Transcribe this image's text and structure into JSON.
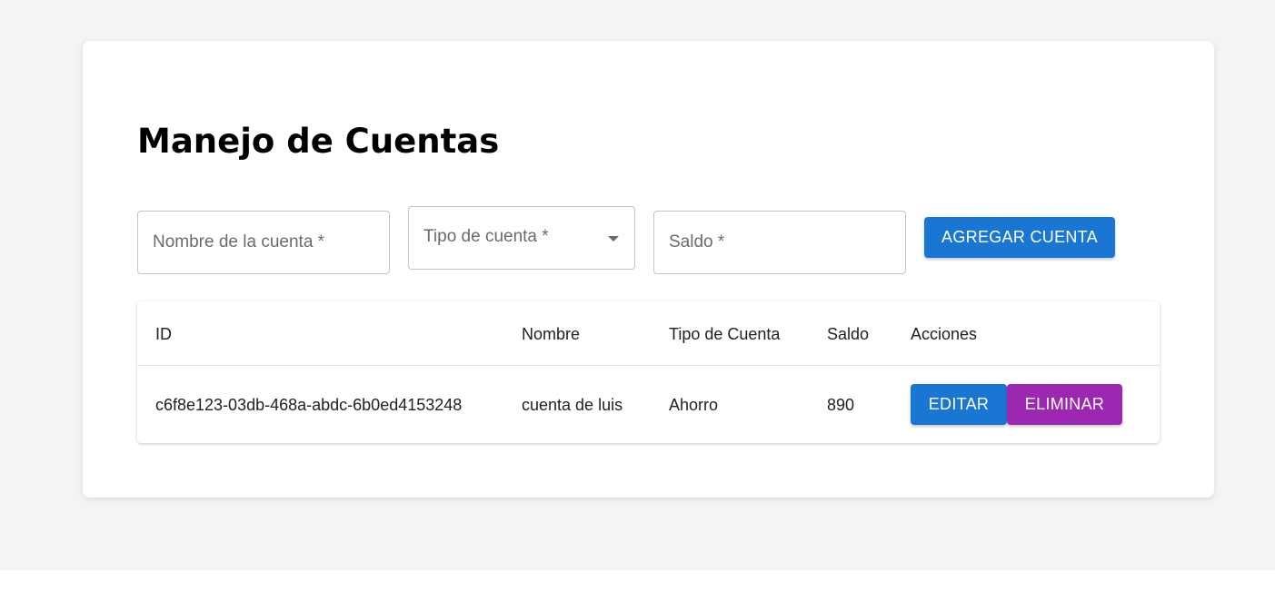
{
  "page": {
    "title": "Manejo de Cuentas"
  },
  "form": {
    "nombre_placeholder": "Nombre de la cuenta *",
    "tipo_placeholder": "Tipo de cuenta *",
    "saldo_placeholder": "Saldo *",
    "add_button_label": "AGREGAR CUENTA"
  },
  "table": {
    "columns": [
      "ID",
      "Nombre",
      "Tipo de Cuenta",
      "Saldo",
      "Acciones"
    ],
    "rows": [
      {
        "id": "c6f8e123-03db-468a-abdc-6b0ed4153248",
        "nombre": "cuenta de luis",
        "tipo": "Ahorro",
        "saldo": "890",
        "edit_label": "EDITAR",
        "delete_label": "ELIMINAR"
      }
    ]
  },
  "icons": {
    "dropdown": "chevron-down-icon"
  },
  "colors": {
    "primary": "#1976d2",
    "secondary": "#9c27b0",
    "page_background": "#f4f4f4"
  }
}
